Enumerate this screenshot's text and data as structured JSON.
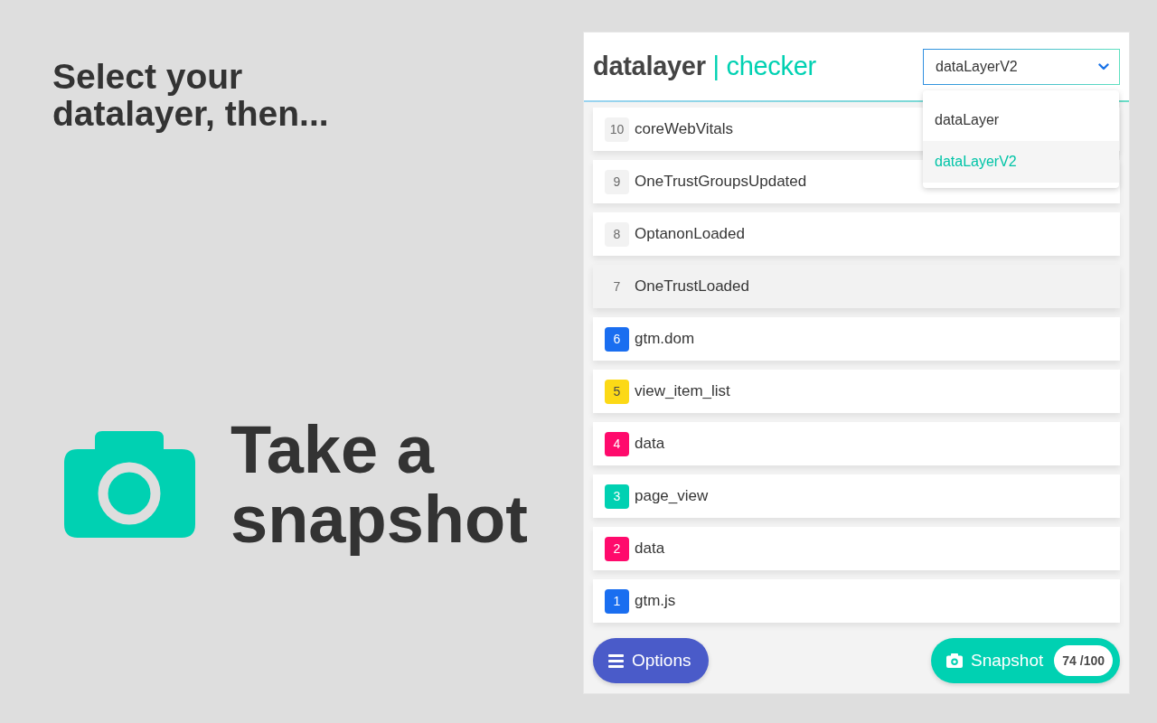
{
  "intro": {
    "heading": "Select your datalayer, then...",
    "cta": "Take a snapshot"
  },
  "header": {
    "logo": {
      "primary": "datalayer",
      "separator": "|",
      "secondary": "checker"
    },
    "select": {
      "value": "dataLayerV2",
      "expanded": true,
      "options": [
        {
          "label": "dataLayer",
          "selected": false
        },
        {
          "label": "dataLayerV2",
          "selected": true
        }
      ]
    }
  },
  "events": [
    {
      "number": "10",
      "name": "coreWebVitals",
      "color": "#f2f2f2",
      "highlighted": false
    },
    {
      "number": "9",
      "name": "OneTrustGroupsUpdated",
      "color": "#f2f2f2",
      "highlighted": false
    },
    {
      "number": "8",
      "name": "OptanonLoaded",
      "color": "#f2f2f2",
      "highlighted": false
    },
    {
      "number": "7",
      "name": "OneTrustLoaded",
      "color": "#f2f2f2",
      "highlighted": true
    },
    {
      "number": "6",
      "name": "gtm.dom",
      "color": "#1a6ef0",
      "highlighted": false
    },
    {
      "number": "5",
      "name": "view_item_list",
      "color": "#fcd916",
      "highlighted": false
    },
    {
      "number": "4",
      "name": "data",
      "color": "#ff0a6c",
      "highlighted": false
    },
    {
      "number": "3",
      "name": "page_view",
      "color": "#00d1b2",
      "highlighted": false
    },
    {
      "number": "2",
      "name": "data",
      "color": "#ff0a6c",
      "highlighted": false
    },
    {
      "number": "1",
      "name": "gtm.js",
      "color": "#1a6ef0",
      "highlighted": false
    }
  ],
  "footer": {
    "options_button": "Options",
    "snapshot_button": "Snapshot",
    "snapshot_count": "74 /100"
  }
}
